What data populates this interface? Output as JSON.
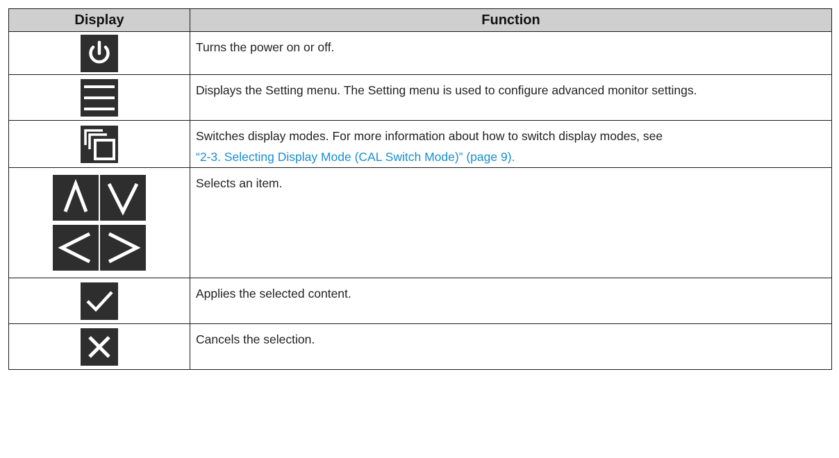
{
  "table": {
    "headers": {
      "display": "Display",
      "function": "Function"
    },
    "rows": [
      {
        "icon": "power-icon",
        "text": "Turns the power on or off."
      },
      {
        "icon": "menu-icon",
        "text": "Displays the Setting menu. The Setting menu is used to configure advanced monitor settings."
      },
      {
        "icon": "display-mode-icon",
        "text": "Switches display modes. For more information about how to switch display modes, see",
        "link": "“2-3. Selecting Display Mode (CAL Switch Mode)” (page 9)."
      },
      {
        "icons": [
          "up-arrow-icon",
          "down-arrow-icon",
          "left-arrow-icon",
          "right-arrow-icon"
        ],
        "text": "Selects an item."
      },
      {
        "icon": "checkmark-icon",
        "text": "Applies the selected content."
      },
      {
        "icon": "close-icon",
        "text": "Cancels the selection."
      }
    ]
  },
  "colors": {
    "header_bg": "#cfcfcf",
    "icon_bg": "#2e2e2e",
    "link": "#1a8fcf"
  }
}
